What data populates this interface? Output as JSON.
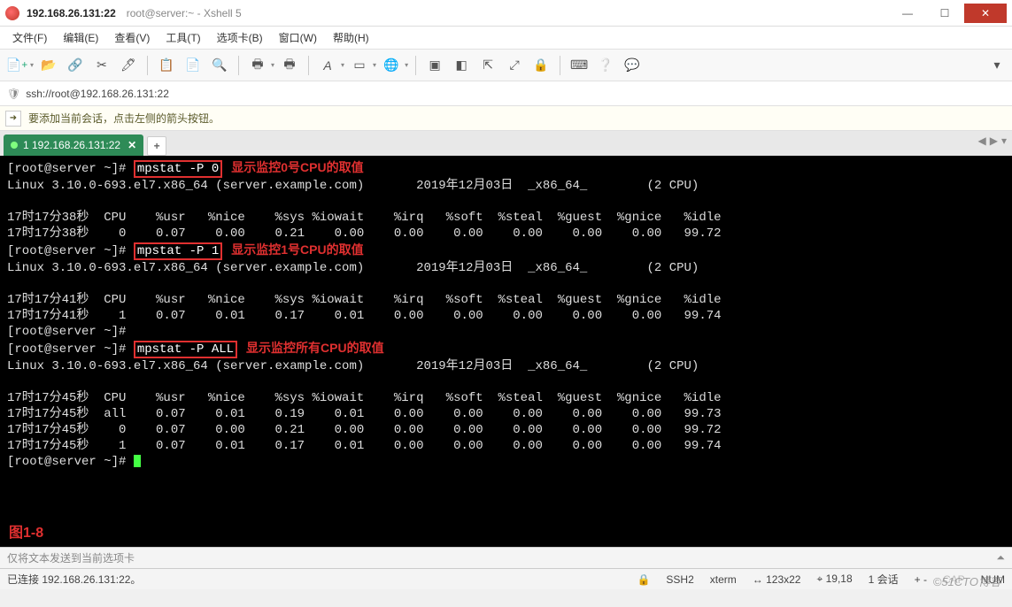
{
  "title": {
    "ip": "192.168.26.131:22",
    "path": "root@server:~ - Xshell 5"
  },
  "window_controls": {
    "min": "—",
    "max": "☐",
    "close": "✕"
  },
  "menu": [
    "文件(F)",
    "编辑(E)",
    "查看(V)",
    "工具(T)",
    "选项卡(B)",
    "窗口(W)",
    "帮助(H)"
  ],
  "toolbar_icons": {
    "new": "new-session-icon",
    "open": "folder-open-icon",
    "link": "connect-icon",
    "disconnect": "disconnect-icon",
    "properties": "properties-icon",
    "copy": "copy-icon",
    "paste": "paste-icon",
    "find": "search-icon",
    "print": "print-icon",
    "printopt": "print-options-icon",
    "font": "font-icon",
    "color": "color-scheme-icon",
    "globe": "encoding-icon",
    "screen": "fullscreen-icon",
    "transparent": "transparency-icon",
    "ontop": "always-on-top-icon",
    "expand": "toggle-broadcast-icon",
    "lock": "lock-icon",
    "keyboard": "keyboard-icon",
    "help": "help-icon",
    "chat": "compose-bar-icon"
  },
  "address": {
    "url": "ssh://root@192.168.26.131:22"
  },
  "infobar": {
    "text": "要添加当前会话，点击左侧的箭头按钮。",
    "arrow": "➜"
  },
  "tab": {
    "label": "1 192.168.26.131:22",
    "close": "✕",
    "add": "+"
  },
  "nav": {
    "left": "◀",
    "right": "▶",
    "down": "▾"
  },
  "terminal": {
    "prompt": "[root@server ~]# ",
    "c1": {
      "cmd": "mpstat -P 0",
      "anno": "显示监控0号CPU的取值"
    },
    "uname1": "Linux 3.10.0-693.el7.x86_64 (server.example.com)       2019年12月03日  _x86_64_        (2 CPU)",
    "hdr1": "17时17分38秒  CPU    %usr   %nice    %sys %iowait    %irq   %soft  %steal  %guest  %gnice   %idle",
    "row1": "17时17分38秒    0    0.07    0.00    0.21    0.00    0.00    0.00    0.00    0.00    0.00   99.72",
    "c2": {
      "cmd": "mpstat -P 1",
      "anno": "显示监控1号CPU的取值"
    },
    "uname2": "Linux 3.10.0-693.el7.x86_64 (server.example.com)       2019年12月03日  _x86_64_        (2 CPU)",
    "hdr2": "17时17分41秒  CPU    %usr   %nice    %sys %iowait    %irq   %soft  %steal  %guest  %gnice   %idle",
    "row2": "17时17分41秒    1    0.07    0.01    0.17    0.01    0.00    0.00    0.00    0.00    0.00   99.74",
    "empty_prompt": "[root@server ~]# ",
    "c3": {
      "cmd": "mpstat -P ALL",
      "anno": "显示监控所有CPU的取值"
    },
    "uname3": "Linux 3.10.0-693.el7.x86_64 (server.example.com)       2019年12月03日  _x86_64_        (2 CPU)",
    "hdr3": "17时17分45秒  CPU    %usr   %nice    %sys %iowait    %irq   %soft  %steal  %guest  %gnice   %idle",
    "row3a": "17时17分45秒  all    0.07    0.01    0.19    0.01    0.00    0.00    0.00    0.00    0.00   99.73",
    "row3b": "17时17分45秒    0    0.07    0.00    0.21    0.00    0.00    0.00    0.00    0.00    0.00   99.72",
    "row3c": "17时17分45秒    1    0.07    0.01    0.17    0.01    0.00    0.00    0.00    0.00    0.00   99.74",
    "fig": "图1-8"
  },
  "sendbar": {
    "placeholder": "仅将文本发送到当前选项卡"
  },
  "status": {
    "conn": "已连接 192.168.26.131:22。",
    "ssh": "SSH2",
    "term": "xterm",
    "size": "123x22",
    "pos": "19,18",
    "sess": "1 会话",
    "cap": "CAP",
    "num": "NUM",
    "lock_icon": "🔒",
    "size_icon": "↔",
    "pos_icon": "⌖",
    "sess_icon": "+ -"
  },
  "watermark": "©51CTO博客"
}
